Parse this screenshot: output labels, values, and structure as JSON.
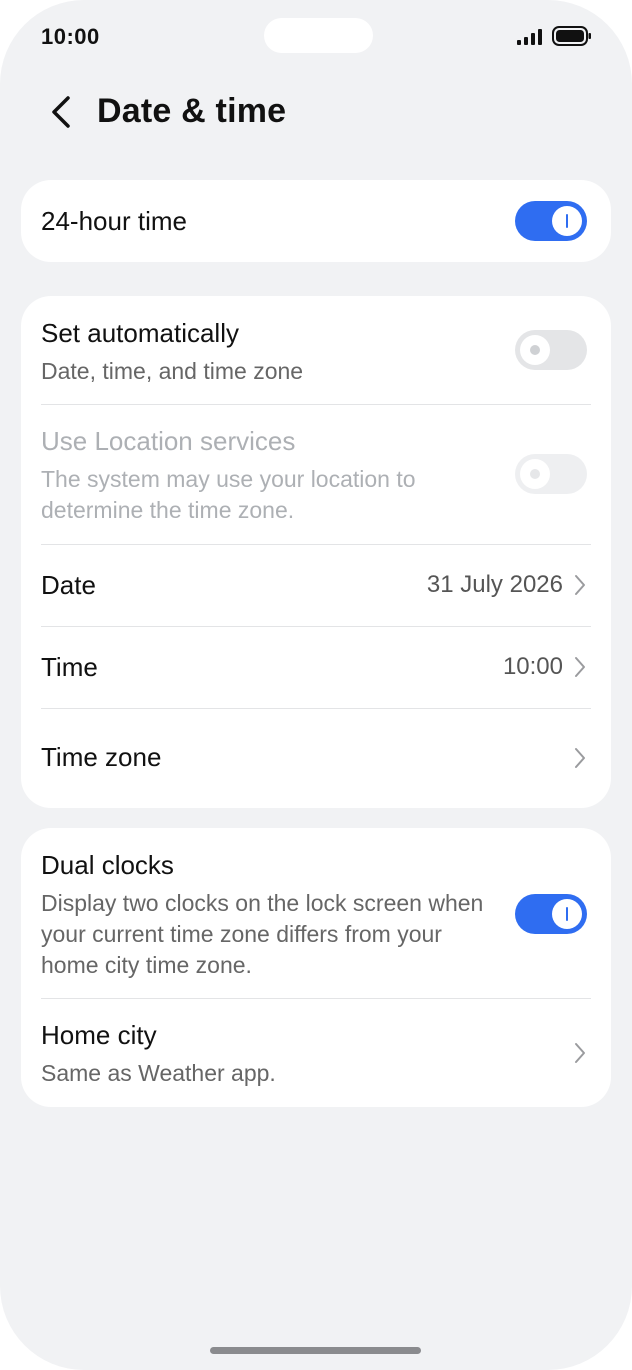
{
  "status_bar": {
    "time": "10:00",
    "icons": [
      "signal-icon",
      "battery-icon"
    ]
  },
  "header": {
    "title": "Date & time",
    "back_icon": "chevron-left-icon"
  },
  "settings": {
    "hour24": {
      "label": "24-hour time",
      "enabled": true
    },
    "set_automatically": {
      "label": "Set automatically",
      "description": "Date, time, and time zone",
      "enabled": false
    },
    "location_services": {
      "label": "Use Location services",
      "description": "The system may use your location to determine the time zone.",
      "enabled": false,
      "disabled": true
    },
    "date": {
      "label": "Date",
      "value": "31 July 2026"
    },
    "time": {
      "label": "Time",
      "value": "10:00"
    },
    "time_zone": {
      "label": "Time zone"
    },
    "dual_clocks": {
      "label": "Dual clocks",
      "description": "Display two clocks on the lock screen when your current time zone differs from your home city time zone.",
      "enabled": true
    },
    "home_city": {
      "label": "Home city",
      "description": "Same as Weather app."
    }
  },
  "colors": {
    "accent": "#2f6df1",
    "background": "#f1f2f4",
    "card": "#ffffff",
    "disabled_text": "#adb0b4"
  }
}
